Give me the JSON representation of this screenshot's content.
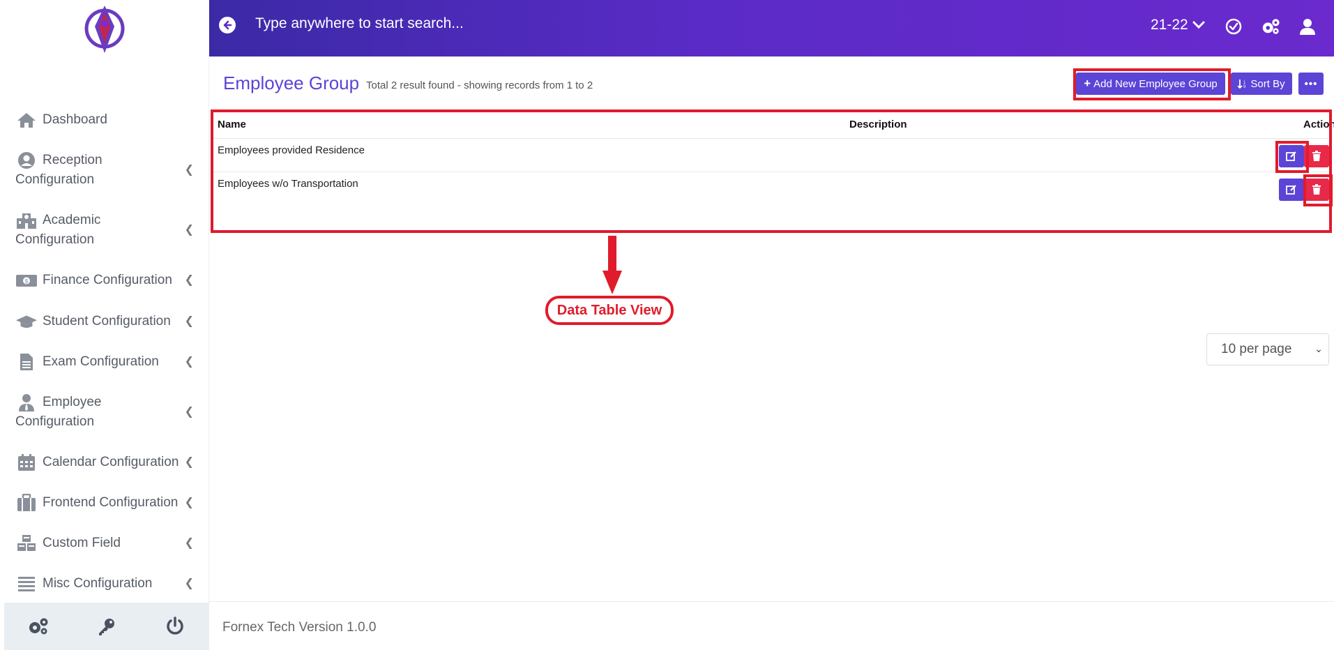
{
  "app": {
    "logo": "school-logo"
  },
  "header": {
    "search_placeholder": "Type anywhere to start search...",
    "session": "21-22"
  },
  "sidebar": {
    "items": [
      {
        "label": "Dashboard",
        "icon": "home-icon"
      },
      {
        "label": "Reception Configuration",
        "icon": "user-circle-icon"
      },
      {
        "label": "Academic Configuration",
        "icon": "school-icon"
      },
      {
        "label": "Finance Configuration",
        "icon": "money-icon"
      },
      {
        "label": "Student Configuration",
        "icon": "graduation-cap-icon"
      },
      {
        "label": "Exam Configuration",
        "icon": "file-icon"
      },
      {
        "label": "Employee Configuration",
        "icon": "user-tie-icon"
      },
      {
        "label": "Calendar Configuration",
        "icon": "calendar-icon"
      },
      {
        "label": "Frontend Configuration",
        "icon": "suitcase-icon"
      },
      {
        "label": "Custom Field",
        "icon": "cubes-icon"
      },
      {
        "label": "Misc Configuration",
        "icon": "list-icon"
      }
    ],
    "bottom": [
      "cogs-icon",
      "key-icon",
      "power-icon"
    ]
  },
  "main": {
    "title": "Employee Group",
    "result_info": "Total 2 result found - showing records from 1 to 2",
    "add_button": "Add New Employee Group",
    "sort_button": "Sort By",
    "table": {
      "columns": [
        "Name",
        "Description",
        "Action"
      ],
      "rows": [
        {
          "name": "Employees provided Residence",
          "description": ""
        },
        {
          "name": "Employees w/o Transportation",
          "description": ""
        }
      ]
    },
    "per_page": "10 per page"
  },
  "annotation": {
    "label": "Data Table View",
    "color": "#e01b2b"
  },
  "footer": {
    "version": "Fornex Tech Version 1.0.0"
  },
  "colors": {
    "accent": "#5b44d6",
    "danger": "#e8294a",
    "header_start": "#3b2aa6",
    "header_end": "#6a2acd"
  }
}
